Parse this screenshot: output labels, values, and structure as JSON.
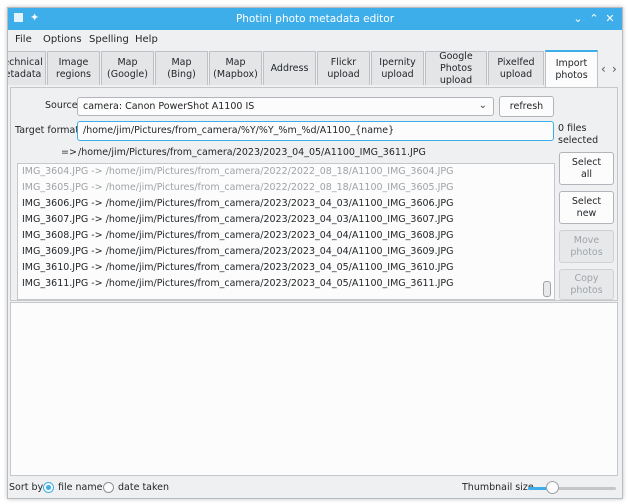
{
  "window": {
    "title": "Photini photo metadata editor",
    "pin_glyph": "✦",
    "min_glyph": "⌄",
    "max_glyph": "⌃",
    "close_glyph": "✕"
  },
  "menu": [
    "File",
    "Options",
    "Spelling",
    "Help"
  ],
  "tabs": [
    {
      "label": "echnical\netadata"
    },
    {
      "label": "Image\nregions"
    },
    {
      "label": "Map\n(Google)"
    },
    {
      "label": "Map\n(Bing)"
    },
    {
      "label": "Map\n(Mapbox)"
    },
    {
      "label": "Address"
    },
    {
      "label": "Flickr\nupload"
    },
    {
      "label": "Ipernity\nupload"
    },
    {
      "label": "Google\nPhotos upload"
    },
    {
      "label": "Pixelfed\nupload"
    },
    {
      "label": "Import\nphotos"
    }
  ],
  "tab_scroll": {
    "left": "‹",
    "right": "›"
  },
  "import": {
    "source_label": "Source",
    "source_value": "camera: Canon PowerShot A1100 IS",
    "combo_arrow": "⌄",
    "refresh_label": "refresh",
    "target_label": "Target format",
    "target_value": "/home/jim/Pictures/from_camera/%Y/%Y_%m_%d/A1100_{name}",
    "example_arrow": "=>",
    "example_path": "/home/jim/Pictures/from_camera/2023/2023_04_05/A1100_IMG_3611.JPG",
    "files_selected": "0 files\nselected",
    "buttons": {
      "select_all": "Select\nall",
      "select_new": "Select\nnew",
      "move_photos": "Move\nphotos",
      "copy_photos": "Copy\nphotos"
    },
    "files": [
      {
        "text": "IMG_3604.JPG -> /home/jim/Pictures/from_camera/2022/2022_08_18/A1100_IMG_3604.JPG",
        "greyed": true
      },
      {
        "text": "IMG_3605.JPG -> /home/jim/Pictures/from_camera/2022/2022_08_18/A1100_IMG_3605.JPG",
        "greyed": true
      },
      {
        "text": "IMG_3606.JPG -> /home/jim/Pictures/from_camera/2023/2023_04_03/A1100_IMG_3606.JPG",
        "greyed": false
      },
      {
        "text": "IMG_3607.JPG -> /home/jim/Pictures/from_camera/2023/2023_04_03/A1100_IMG_3607.JPG",
        "greyed": false
      },
      {
        "text": "IMG_3608.JPG -> /home/jim/Pictures/from_camera/2023/2023_04_04/A1100_IMG_3608.JPG",
        "greyed": false
      },
      {
        "text": "IMG_3609.JPG -> /home/jim/Pictures/from_camera/2023/2023_04_04/A1100_IMG_3609.JPG",
        "greyed": false
      },
      {
        "text": "IMG_3610.JPG -> /home/jim/Pictures/from_camera/2023/2023_04_05/A1100_IMG_3610.JPG",
        "greyed": false
      },
      {
        "text": "IMG_3611.JPG -> /home/jim/Pictures/from_camera/2023/2023_04_05/A1100_IMG_3611.JPG",
        "greyed": false
      }
    ]
  },
  "statusbar": {
    "sort_label": "Sort by",
    "sort_file_name": "file name",
    "sort_date_taken": "date taken",
    "thumbnail_size_label": "Thumbnail size",
    "thumbnail_size_level": 0.24
  },
  "colors": {
    "accent": "#3daee9"
  }
}
